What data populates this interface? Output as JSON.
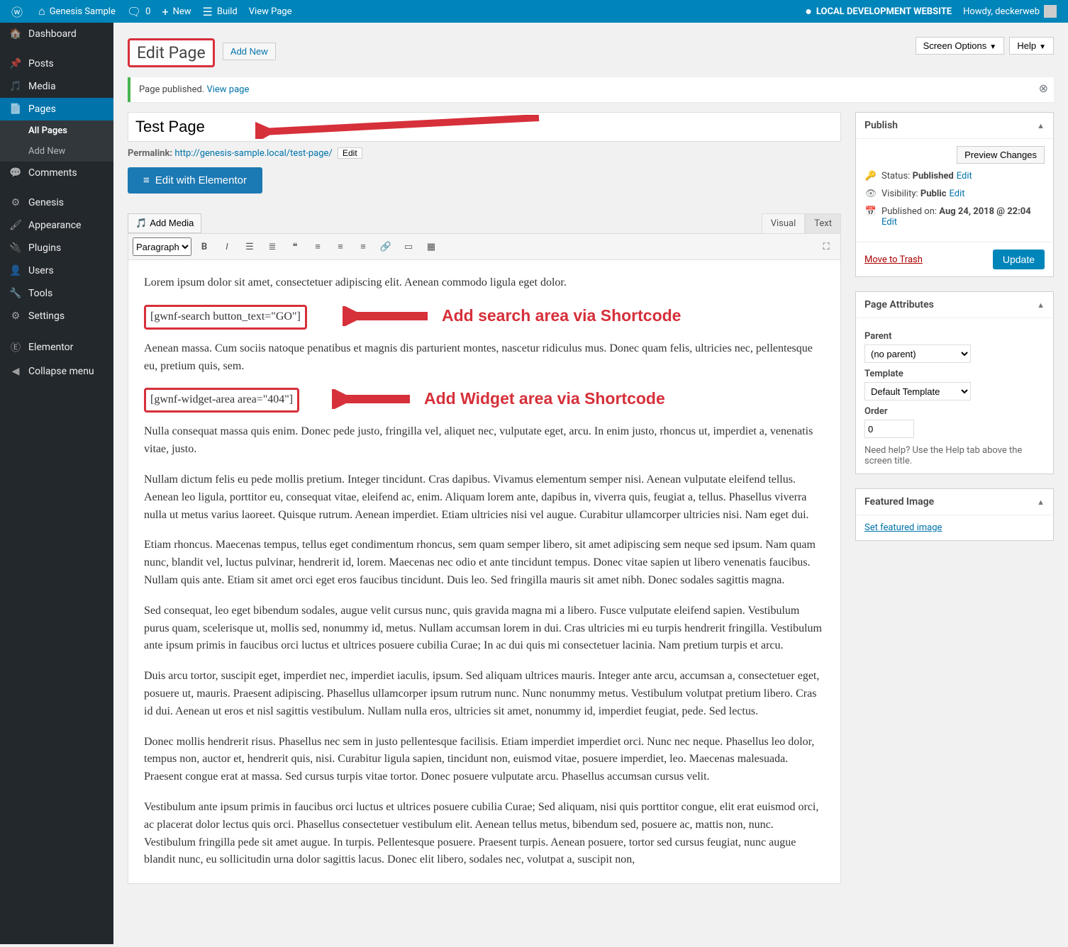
{
  "adminbar": {
    "site_name": "Genesis Sample",
    "comments": "0",
    "new": "New",
    "build": "Build",
    "view_page": "View Page",
    "local_notice": "LOCAL DEVELOPMENT WEBSITE",
    "howdy": "Howdy, deckerweb"
  },
  "topright": {
    "screen_options": "Screen Options",
    "help": "Help"
  },
  "menu": {
    "dashboard": "Dashboard",
    "posts": "Posts",
    "media": "Media",
    "pages": "Pages",
    "pages_sub_all": "All Pages",
    "pages_sub_add": "Add New",
    "comments": "Comments",
    "genesis": "Genesis",
    "appearance": "Appearance",
    "plugins": "Plugins",
    "users": "Users",
    "tools": "Tools",
    "settings": "Settings",
    "elementor": "Elementor",
    "collapse": "Collapse menu"
  },
  "heading": {
    "title": "Edit Page",
    "add_new": "Add New"
  },
  "notice": {
    "text": "Page published.",
    "link": "View page"
  },
  "title_field": "Test Page",
  "permalink": {
    "label": "Permalink:",
    "base": "http://genesis-sample.local/",
    "slug": "test-page/",
    "edit": "Edit"
  },
  "elementor_btn": "Edit with Elementor",
  "editor": {
    "add_media": "Add Media",
    "tab_visual": "Visual",
    "tab_text": "Text",
    "format_select": "Paragraph",
    "p1": "Lorem ipsum dolor sit amet, consectetuer adipiscing elit. Aenean commodo ligula eget dolor.",
    "shortcode1": "[gwnf-search button_text=\"GO\"]",
    "annot1": "Add search area via Shortcode",
    "p2": "Aenean massa. Cum sociis natoque penatibus et magnis dis parturient montes, nascetur ridiculus mus. Donec quam felis, ultricies nec, pellentesque eu, pretium quis, sem.",
    "shortcode2": "[gwnf-widget-area area=\"404\"]",
    "annot2": "Add Widget area via Shortcode",
    "p3": "Nulla consequat massa quis enim. Donec pede justo, fringilla vel, aliquet nec, vulputate eget, arcu. In enim justo, rhoncus ut, imperdiet a, venenatis vitae, justo.",
    "p4": "Nullam dictum felis eu pede mollis pretium. Integer tincidunt. Cras dapibus. Vivamus elementum semper nisi. Aenean vulputate eleifend tellus. Aenean leo ligula, porttitor eu, consequat vitae, eleifend ac, enim. Aliquam lorem ante, dapibus in, viverra quis, feugiat a, tellus. Phasellus viverra nulla ut metus varius laoreet. Quisque rutrum. Aenean imperdiet. Etiam ultricies nisi vel augue. Curabitur ullamcorper ultricies nisi. Nam eget dui.",
    "p5": "Etiam rhoncus. Maecenas tempus, tellus eget condimentum rhoncus, sem quam semper libero, sit amet adipiscing sem neque sed ipsum. Nam quam nunc, blandit vel, luctus pulvinar, hendrerit id, lorem. Maecenas nec odio et ante tincidunt tempus. Donec vitae sapien ut libero venenatis faucibus. Nullam quis ante. Etiam sit amet orci eget eros faucibus tincidunt. Duis leo. Sed fringilla mauris sit amet nibh. Donec sodales sagittis magna.",
    "p6": "Sed consequat, leo eget bibendum sodales, augue velit cursus nunc, quis gravida magna mi a libero. Fusce vulputate eleifend sapien. Vestibulum purus quam, scelerisque ut, mollis sed, nonummy id, metus. Nullam accumsan lorem in dui. Cras ultricies mi eu turpis hendrerit fringilla. Vestibulum ante ipsum primis in faucibus orci luctus et ultrices posuere cubilia Curae; In ac dui quis mi consectetuer lacinia. Nam pretium turpis et arcu.",
    "p7": "Duis arcu tortor, suscipit eget, imperdiet nec, imperdiet iaculis, ipsum. Sed aliquam ultrices mauris. Integer ante arcu, accumsan a, consectetuer eget, posuere ut, mauris. Praesent adipiscing. Phasellus ullamcorper ipsum rutrum nunc. Nunc nonummy metus. Vestibulum volutpat pretium libero. Cras id dui. Aenean ut eros et nisl sagittis vestibulum. Nullam nulla eros, ultricies sit amet, nonummy id, imperdiet feugiat, pede. Sed lectus.",
    "p8": "Donec mollis hendrerit risus. Phasellus nec sem in justo pellentesque facilisis. Etiam imperdiet imperdiet orci. Nunc nec neque. Phasellus leo dolor, tempus non, auctor et, hendrerit quis, nisi. Curabitur ligula sapien, tincidunt non, euismod vitae, posuere imperdiet, leo. Maecenas malesuada. Praesent congue erat at massa. Sed cursus turpis vitae tortor. Donec posuere vulputate arcu. Phasellus accumsan cursus velit.",
    "p9": "Vestibulum ante ipsum primis in faucibus orci luctus et ultrices posuere cubilia Curae; Sed aliquam, nisi quis porttitor congue, elit erat euismod orci, ac placerat dolor lectus quis orci. Phasellus consectetuer vestibulum elit. Aenean tellus metus, bibendum sed, posuere ac, mattis non, nunc. Vestibulum fringilla pede sit amet augue. In turpis. Pellentesque posuere. Praesent turpis. Aenean posuere, tortor sed cursus feugiat, nunc augue blandit nunc, eu sollicitudin urna dolor sagittis lacus. Donec elit libero, sodales nec, volutpat a, suscipit non,"
  },
  "publish": {
    "header": "Publish",
    "preview": "Preview Changes",
    "status_label": "Status:",
    "status_value": "Published",
    "visibility_label": "Visibility:",
    "visibility_value": "Public",
    "published_label": "Published on:",
    "published_value": "Aug 24, 2018 @ 22:04",
    "edit": "Edit",
    "trash": "Move to Trash",
    "update": "Update"
  },
  "attrs": {
    "header": "Page Attributes",
    "parent_label": "Parent",
    "parent_value": "(no parent)",
    "template_label": "Template",
    "template_value": "Default Template",
    "order_label": "Order",
    "order_value": "0",
    "help": "Need help? Use the Help tab above the screen title."
  },
  "featured": {
    "header": "Featured Image",
    "link": "Set featured image"
  }
}
